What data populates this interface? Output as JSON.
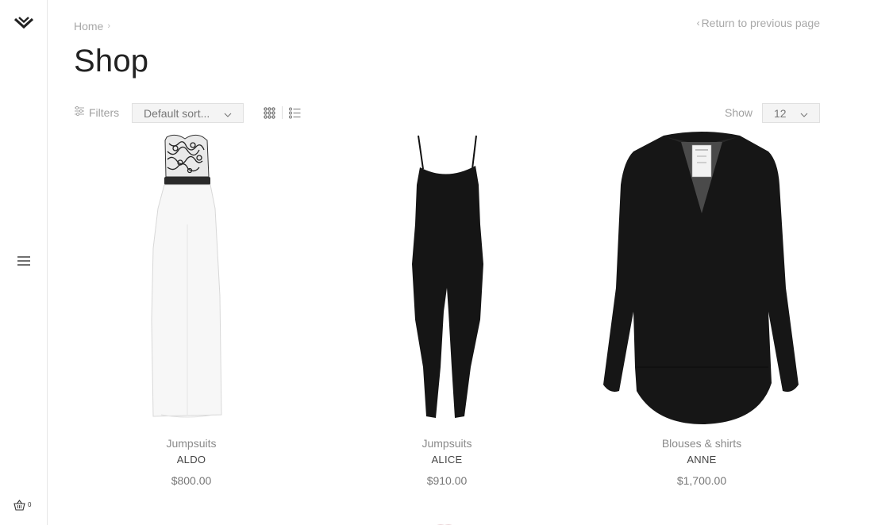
{
  "sidebar": {
    "logo_icon": "chevron-logo-icon",
    "menu_icon": "hamburger-icon",
    "cart_icon": "basket-icon",
    "cart_count": "0"
  },
  "breadcrumb": {
    "home_label": "Home",
    "separator": "›"
  },
  "return_link": {
    "chevron": "‹",
    "label": "Return to previous page"
  },
  "page_title": "Shop",
  "toolbar": {
    "filters_label": "Filters",
    "sort_value": "Default sort...",
    "show_label": "Show",
    "show_value": "12",
    "grid_view_icon": "grid-view-icon",
    "list_view_icon": "list-view-icon"
  },
  "products": [
    {
      "category": "Jumpsuits",
      "name": "ALDO",
      "price": "$800.00",
      "image": "white-strapless-jumpsuit-lace-top"
    },
    {
      "category": "Jumpsuits",
      "name": "ALICE",
      "price": "$910.00",
      "image": "black-spaghetti-strap-jumpsuit"
    },
    {
      "category": "Blouses & shirts",
      "name": "ANNE",
      "price": "$1,700.00",
      "image": "black-long-sleeve-blouse"
    }
  ],
  "colors": {
    "text_muted": "#a8a8a8",
    "title": "#222222",
    "select_bg": "#f4f4f4",
    "border": "#e6e6e6"
  }
}
